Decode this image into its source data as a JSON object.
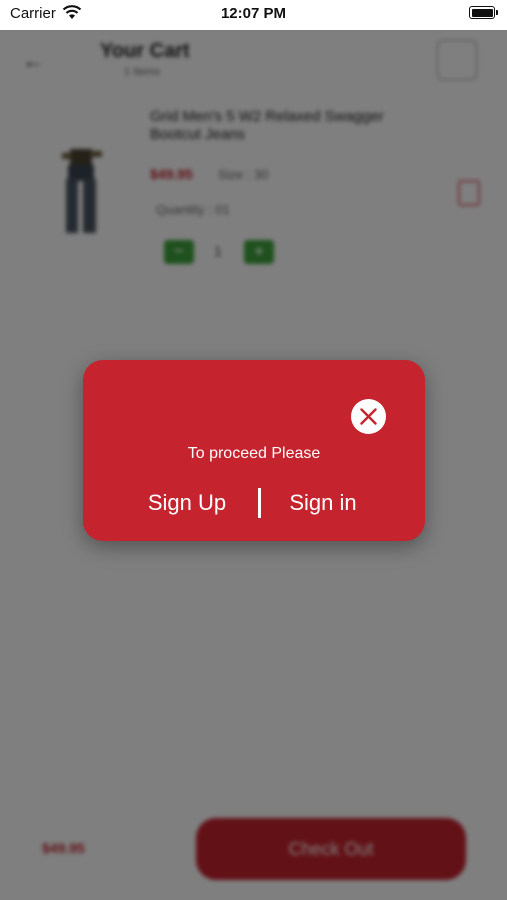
{
  "status_bar": {
    "carrier": "Carrier",
    "time": "12:07 PM"
  },
  "header": {
    "title": "Your Cart",
    "subtitle": "1 Items"
  },
  "product": {
    "name": "Grid Men's 5 W2 Relaxed Swagger Bootcut Jeans",
    "price": "$49.95",
    "size": "Size : 30",
    "quantity_label": "Quantity : 01",
    "quantity_value": "1"
  },
  "footer": {
    "total": "$49.95",
    "checkout_label": "Check Out"
  },
  "dialog": {
    "message": "To proceed Please",
    "signup_label": "Sign Up",
    "signin_label": "Sign in"
  },
  "colors": {
    "accent": "#c5232d",
    "stepper": "#3da23a"
  },
  "icons": [
    "wifi-icon",
    "battery-icon",
    "back-arrow-icon",
    "close-icon",
    "trash-icon"
  ]
}
